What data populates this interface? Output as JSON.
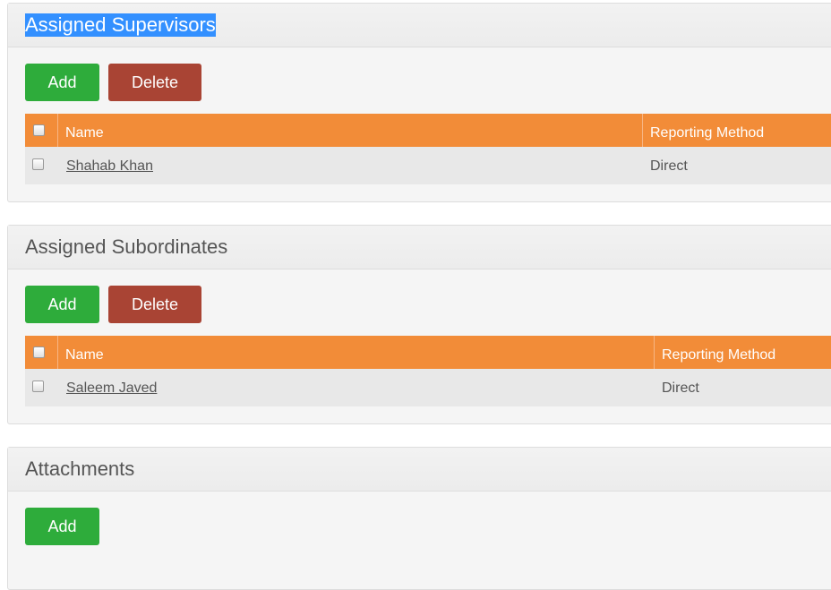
{
  "supervisors": {
    "title": "Assigned Supervisors",
    "add_label": "Add",
    "delete_label": "Delete",
    "columns": {
      "name": "Name",
      "method": "Reporting Method"
    },
    "rows": [
      {
        "name": "Shahab Khan",
        "method": "Direct"
      }
    ]
  },
  "subordinates": {
    "title": "Assigned Subordinates",
    "add_label": "Add",
    "delete_label": "Delete",
    "columns": {
      "name": "Name",
      "method": "Reporting Method"
    },
    "rows": [
      {
        "name": "Saleem Javed",
        "method": "Direct"
      }
    ]
  },
  "attachments": {
    "title": "Attachments",
    "add_label": "Add"
  },
  "colors": {
    "table_header": "#f28c38",
    "add_button": "#2eac3b",
    "delete_button": "#a94434",
    "selection": "#3390ff"
  }
}
